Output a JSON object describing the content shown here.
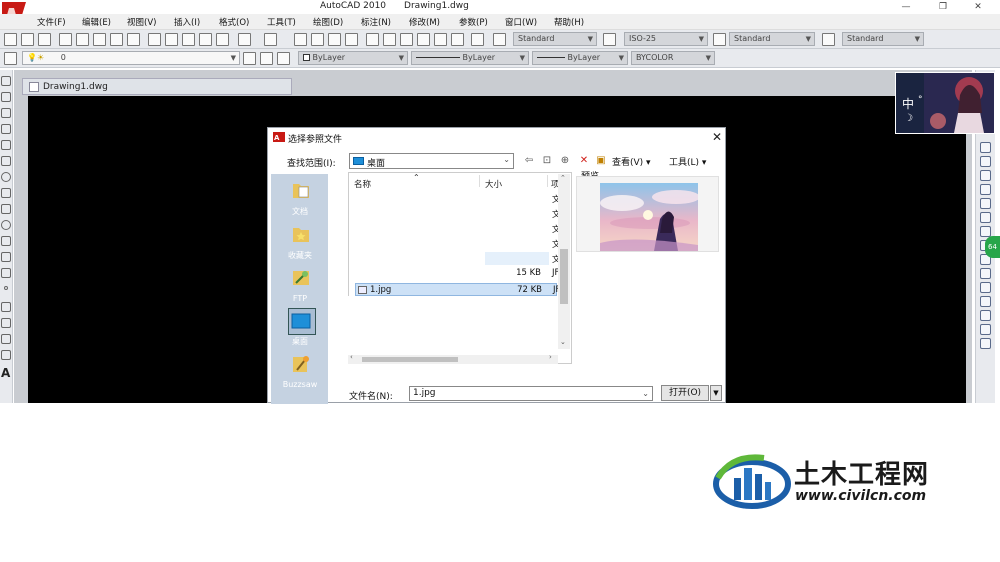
{
  "window": {
    "title": "AutoCAD 2010",
    "drawing_name": "Drawing1.dwg",
    "controls": [
      "—",
      "❐",
      "✕"
    ]
  },
  "menu": [
    "文件(F)",
    "编辑(E)",
    "视图(V)",
    "插入(I)",
    "格式(O)",
    "工具(T)",
    "绘图(D)",
    "标注(N)",
    "修改(M)",
    "参数(P)",
    "窗口(W)",
    "帮助(H)"
  ],
  "toolbar": {
    "text_style": "Standard",
    "dim_style": "ISO-25",
    "table_style": "Standard",
    "mleader_style": "Standard",
    "layer": "0",
    "color": "ByLayer",
    "linetype": "ByLayer",
    "lineweight": "ByLayer",
    "plot_style": "BYCOLOR"
  },
  "document_tab": {
    "label": "Drawing1.dwg"
  },
  "ime": {
    "mode": "中",
    "punct": "°",
    "moon": "☽"
  },
  "badge": {
    "value": "64"
  },
  "dialog": {
    "title": "选择参照文件",
    "look_in_label": "查找范围(I):",
    "look_in_value": "桌面",
    "views_label": "查看(V)",
    "tools_label": "工具(L)",
    "places": [
      "文档",
      "收藏夹",
      "FTP",
      "桌面",
      "Buzzsaw"
    ],
    "columns": {
      "name": "名称",
      "size": "大小",
      "type": "项"
    },
    "rows": [
      {
        "name": "",
        "size": "",
        "type": "文"
      },
      {
        "name": "",
        "size": "",
        "type": "文"
      },
      {
        "name": "",
        "size": "",
        "type": "文"
      },
      {
        "name": "",
        "size": "",
        "type": "文"
      },
      {
        "name": "",
        "size": "",
        "type": "文"
      },
      {
        "name": "",
        "size": "15 KB",
        "type": "JF"
      },
      {
        "name": "1.jpg",
        "size": "72 KB",
        "type": "JF"
      }
    ],
    "preview_label": "预览",
    "filename_label": "文件名(N):",
    "filename_value": "1.jpg",
    "open_label": "打开(O)"
  },
  "watermark": {
    "title": "土木工程网",
    "url": "www.civilcn.com"
  }
}
